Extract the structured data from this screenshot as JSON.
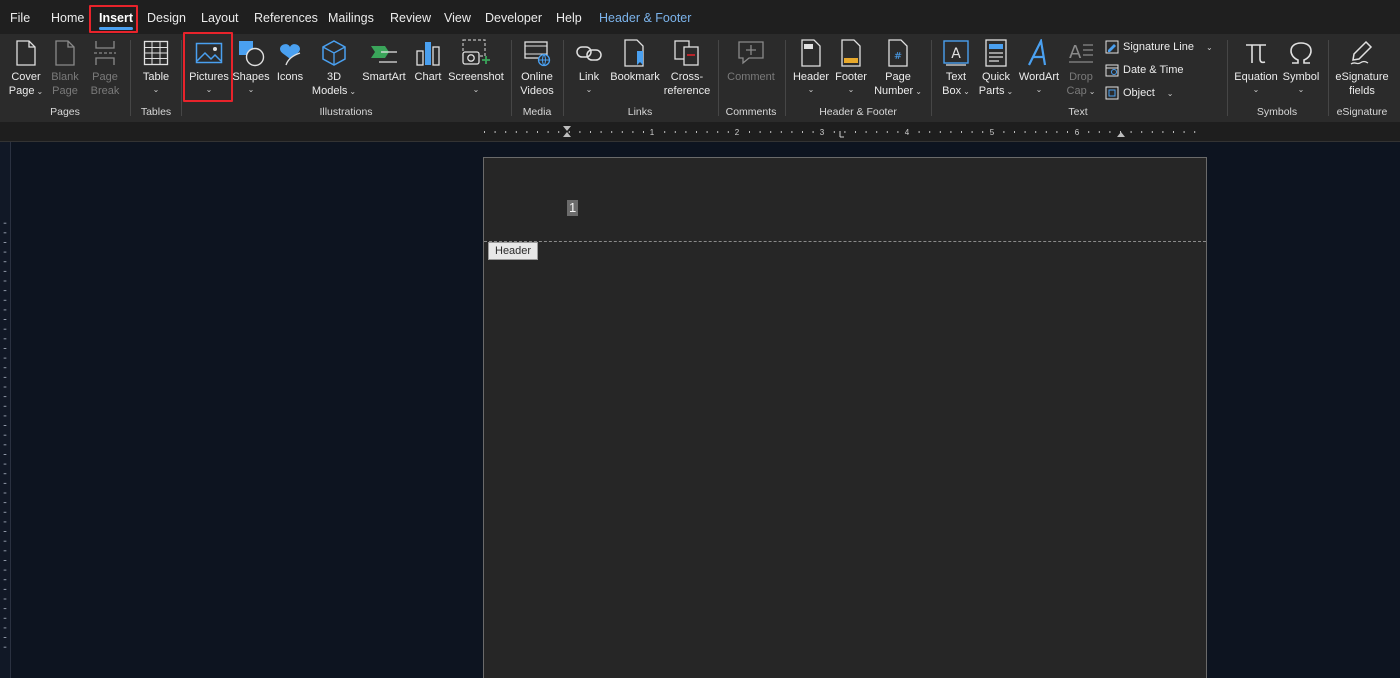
{
  "tabs": {
    "file": "File",
    "home": "Home",
    "insert": "Insert",
    "design": "Design",
    "layout": "Layout",
    "references": "References",
    "mailings": "Mailings",
    "review": "Review",
    "view": "View",
    "developer": "Developer",
    "help": "Help",
    "header_footer": "Header & Footer"
  },
  "ribbon": {
    "pages": {
      "label": "Pages",
      "cover_page": [
        "Cover",
        "Page"
      ],
      "blank_page": [
        "Blank",
        "Page"
      ],
      "page_break": [
        "Page",
        "Break"
      ]
    },
    "tables": {
      "label": "Tables",
      "table": "Table"
    },
    "illustrations": {
      "label": "Illustrations",
      "pictures": "Pictures",
      "shapes": "Shapes",
      "icons": "Icons",
      "models_3d": [
        "3D",
        "Models"
      ],
      "smartart": "SmartArt",
      "chart": "Chart",
      "screenshot": "Screenshot"
    },
    "media": {
      "label": "Media",
      "online_videos": [
        "Online",
        "Videos"
      ]
    },
    "links": {
      "label": "Links",
      "link": "Link",
      "bookmark": "Bookmark",
      "cross_reference": [
        "Cross-",
        "reference"
      ]
    },
    "comments": {
      "label": "Comments",
      "comment": "Comment"
    },
    "header_footer": {
      "label": "Header & Footer",
      "header": "Header",
      "footer": "Footer",
      "page_number": [
        "Page",
        "Number"
      ]
    },
    "text": {
      "label": "Text",
      "text_box": [
        "Text",
        "Box"
      ],
      "quick_parts": [
        "Quick",
        "Parts"
      ],
      "wordart": "WordArt",
      "drop_cap": [
        "Drop",
        "Cap"
      ],
      "signature_line": "Signature Line",
      "date_time": "Date & Time",
      "object": "Object"
    },
    "symbols": {
      "label": "Symbols",
      "equation": "Equation",
      "symbol": "Symbol"
    },
    "esignature": {
      "label": "eSignature",
      "fields": [
        "eSignature",
        "fields"
      ]
    }
  },
  "ruler": {
    "numbers": [
      "1",
      "2",
      "3",
      "4",
      "5",
      "6"
    ]
  },
  "document": {
    "page_number": "1",
    "header_tag": "Header"
  },
  "colors": {
    "accent": "#4aa0f0",
    "highlight": "#e8232b",
    "contextual_tab": "#7cb4ec"
  }
}
